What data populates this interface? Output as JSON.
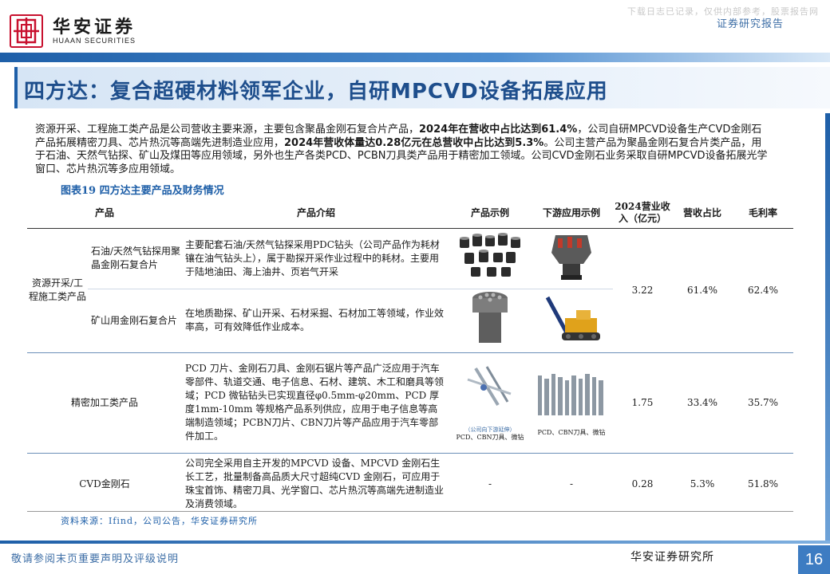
{
  "header": {
    "brand_cn": "华安证券",
    "brand_en": "HUAAN SECURITIES",
    "watermark": "下载日志已记录，仅供内部参考，股票报告网",
    "report_type": "证券研究报告"
  },
  "title": "四方达：复合超硬材料领军企业，自研MPCVD设备拓展应用",
  "paragraph": {
    "p1": "资源开采、工程施工类产品是公司营收主要来源，主要包含聚晶金刚石复合片产品，",
    "p1b": "2024年在营收中占比达到61.4%",
    "p2": "，公司自研",
    "p3": "MPCVD设备生产CVD金刚石产品拓展精密刀具、芯片热沉等高端先进制造业应用，",
    "p3b": "2024年营收体量达0.28亿元在总营收中占比达到5.3%",
    "p4": "。公司主营产品为聚晶金刚石复合片类产品，用于石油、天然气钻探、矿山及煤田等应用领域，另外也生产各类PCD、PCBN刀具类产品用于精密加工领域。公司CVD金刚石业务采取自研MPCVD设备拓展光学窗口、芯片热沉等多应用领域。"
  },
  "figure_title": "图表19 四方达主要产品及财务情况",
  "table": {
    "headers": [
      "产品",
      "产品介绍",
      "产品示例",
      "下游应用示例",
      "2024营业收入（亿元）",
      "营收占比",
      "毛利率"
    ],
    "rows": [
      {
        "category": "资源开采/工程施工类产品",
        "sub1": "石油/天然气钻探用聚晶金刚石复合片",
        "intro1": "主要配套石油/天然气钻探采用PDC钻头（公司产品作为耗材镶在油气钻头上），属于勘探开采作业过程中的耗材。主要用于陆地油田、海上油井、页岩气开采",
        "sub2": "矿山用金刚石复合片",
        "intro2": "在地质勘探、矿山开采、石材采掘、石材加工等领域，作业效率高，可有效降低作业成本。",
        "revenue": "3.22",
        "share": "61.4%",
        "margin": "62.4%"
      },
      {
        "category": "精密加工类产品",
        "intro": "PCD 刀片、金刚石刀具、金刚石锯片等产品广泛应用于汽车零部件、轨道交通、电子信息、石材、建筑、木工和磨具等领域；PCD 微钻钻头已实现直径φ0.5mm-φ20mm、PCD 厚度1mm-10mm 等规格产品系列供应，应用于电子信息等高端制造领域；PCBN刀片、CBN刀片等产品应用于汽车零部件加工。",
        "img_caption1": "（公司向下游延伸）",
        "img_caption1b": "PCD、CBN刀具、微钻",
        "img_caption2": "PCD、CBN刀具、微钻",
        "revenue": "1.75",
        "share": "33.4%",
        "margin": "35.7%"
      },
      {
        "category": "CVD金刚石",
        "intro": "公司完全采用自主开发的MPCVD 设备、MPCVD 金刚石生长工艺，批量制备高品质大尺寸超纯CVD 金刚石，可应用于珠宝首饰、精密刀具、光学窗口、芯片热沉等高端先进制造业及消费领域。",
        "example": "-",
        "downstream": "-",
        "revenue": "0.28",
        "share": "5.3%",
        "margin": "51.8%"
      }
    ]
  },
  "source": "资料来源：Ifind，公司公告，华安证券研究所",
  "footer": {
    "left": "敬请参阅末页重要声明及评级说明",
    "right": "华安证券研究所",
    "page": "16"
  },
  "colors": {
    "brand_red": "#c8102e",
    "brand_blue": "#1e5fa8",
    "title_blue": "#1e4e8c"
  }
}
